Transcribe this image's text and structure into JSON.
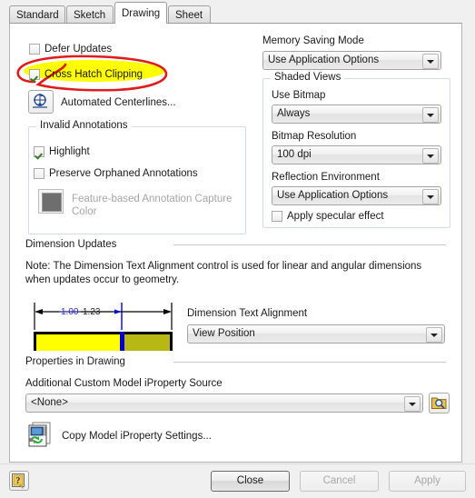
{
  "dialog": {
    "tabs": [
      {
        "label": "Standard",
        "active": false
      },
      {
        "label": "Sketch",
        "active": false
      },
      {
        "label": "Drawing",
        "active": true
      },
      {
        "label": "Sheet",
        "active": false
      }
    ]
  },
  "left": {
    "defer_updates": {
      "label": "Defer Updates",
      "checked": false
    },
    "cross_hatch_clipping": {
      "label": "Cross Hatch Clipping",
      "checked": true
    },
    "automated_centerlines": {
      "label": "Automated Centerlines...",
      "icon": "centerline-icon"
    },
    "invalid_annotations": {
      "title": "Invalid Annotations",
      "highlight": {
        "label": "Highlight",
        "checked": true
      },
      "preserve_orphaned": {
        "label": "Preserve Orphaned Annotations",
        "checked": false
      },
      "capture_color": {
        "label": "Feature-based Annotation Capture Color",
        "swatch_color": "#6e6e6e",
        "disabled": true
      }
    }
  },
  "right": {
    "memory_saving_mode": {
      "label": "Memory Saving Mode",
      "value": "Use Application Options"
    },
    "shaded_views": {
      "title": "Shaded Views",
      "use_bitmap": {
        "label": "Use Bitmap",
        "value": "Always"
      },
      "bitmap_resolution": {
        "label": "Bitmap Resolution",
        "value": "100 dpi"
      },
      "reflection_environment": {
        "label": "Reflection Environment",
        "value": "Use Application Options"
      },
      "apply_specular": {
        "label": "Apply specular effect",
        "checked": false
      }
    }
  },
  "dimension_updates": {
    "header": "Dimension Updates",
    "note": "Note: The Dimension Text Alignment control is used for linear and angular dimensions when updates occur to geometry.",
    "preview": {
      "old_value": "1.00",
      "new_value": "1.23",
      "left_fill_color": "#ffff00",
      "right_fill_color": "#b8b814",
      "divider_color": "#0000d0"
    },
    "alignment": {
      "label": "Dimension Text Alignment",
      "value": "View Position"
    }
  },
  "properties_in_drawing": {
    "header": "Properties in Drawing",
    "source_label": "Additional Custom Model iProperty Source",
    "source_value": "<None>",
    "browse_icon": "folder-search-icon",
    "copy_settings": {
      "label": "Copy Model iProperty Settings...",
      "icon": "copy-iproperty-icon"
    }
  },
  "footer": {
    "help_icon": "help-question-icon",
    "close": {
      "label": "Close",
      "enabled": true,
      "default": true
    },
    "cancel": {
      "label": "Cancel",
      "enabled": false
    },
    "apply": {
      "label": "Apply",
      "enabled": false
    }
  },
  "annotation": {
    "highlight_color": "#ffff00",
    "loop_color": "#e01b1b",
    "target": "Cross Hatch Clipping"
  }
}
